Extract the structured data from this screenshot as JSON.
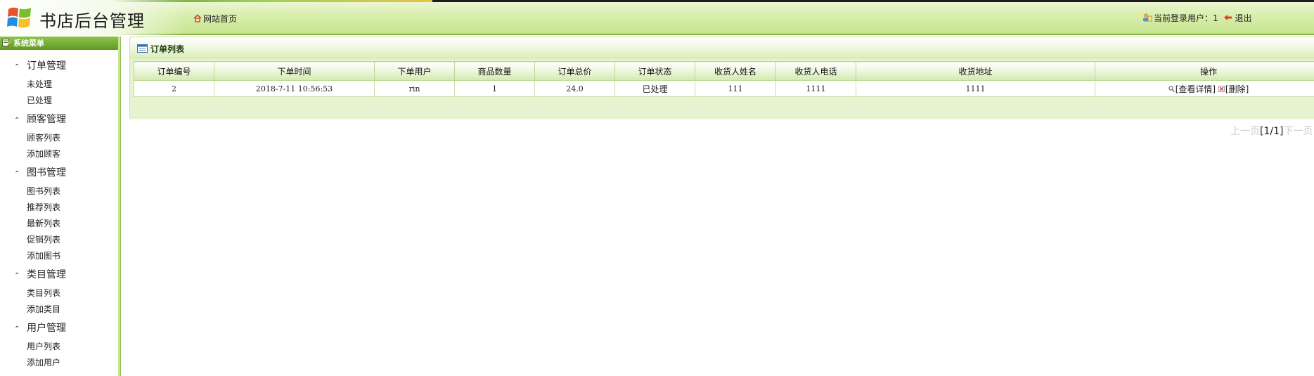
{
  "header": {
    "app_title": "书店后台管理",
    "home_link": "网站首页",
    "current_user_label": "当前登录用户：1",
    "logout_label": "退出"
  },
  "sidebar": {
    "title": "系统菜单",
    "groups": [
      {
        "title": "订单管理",
        "items": [
          "未处理",
          "已处理"
        ]
      },
      {
        "title": "顾客管理",
        "items": [
          "顾客列表",
          "添加顾客"
        ]
      },
      {
        "title": "图书管理",
        "items": [
          "图书列表",
          "推荐列表",
          "最新列表",
          "促销列表",
          "添加图书"
        ]
      },
      {
        "title": "类目管理",
        "items": [
          "类目列表",
          "添加类目"
        ]
      },
      {
        "title": "用户管理",
        "items": [
          "用户列表",
          "添加用户"
        ]
      }
    ]
  },
  "main": {
    "panel_title": "订单列表",
    "table": {
      "headers": [
        "订单编号",
        "下单时间",
        "下单用户",
        "商品数量",
        "订单总价",
        "订单状态",
        "收货人姓名",
        "收货人电话",
        "收货地址",
        "操作"
      ],
      "rows": [
        {
          "id": "2",
          "time": "2018-7-11 10:56:53",
          "user": "rin",
          "quantity": "1",
          "total": "24.0",
          "status": "已处理",
          "receiver_name": "111",
          "receiver_phone": "1111",
          "address": "1111",
          "actions": {
            "view": "[查看详情]",
            "delete": "[删除]"
          }
        }
      ]
    },
    "pager": {
      "prev": "上一页",
      "current": "[1/1]",
      "next": "下一页"
    }
  },
  "colors": {
    "header_green": "#c6e48e",
    "sidebar_header": "#5f9a25",
    "border_green": "#bcd98f"
  }
}
